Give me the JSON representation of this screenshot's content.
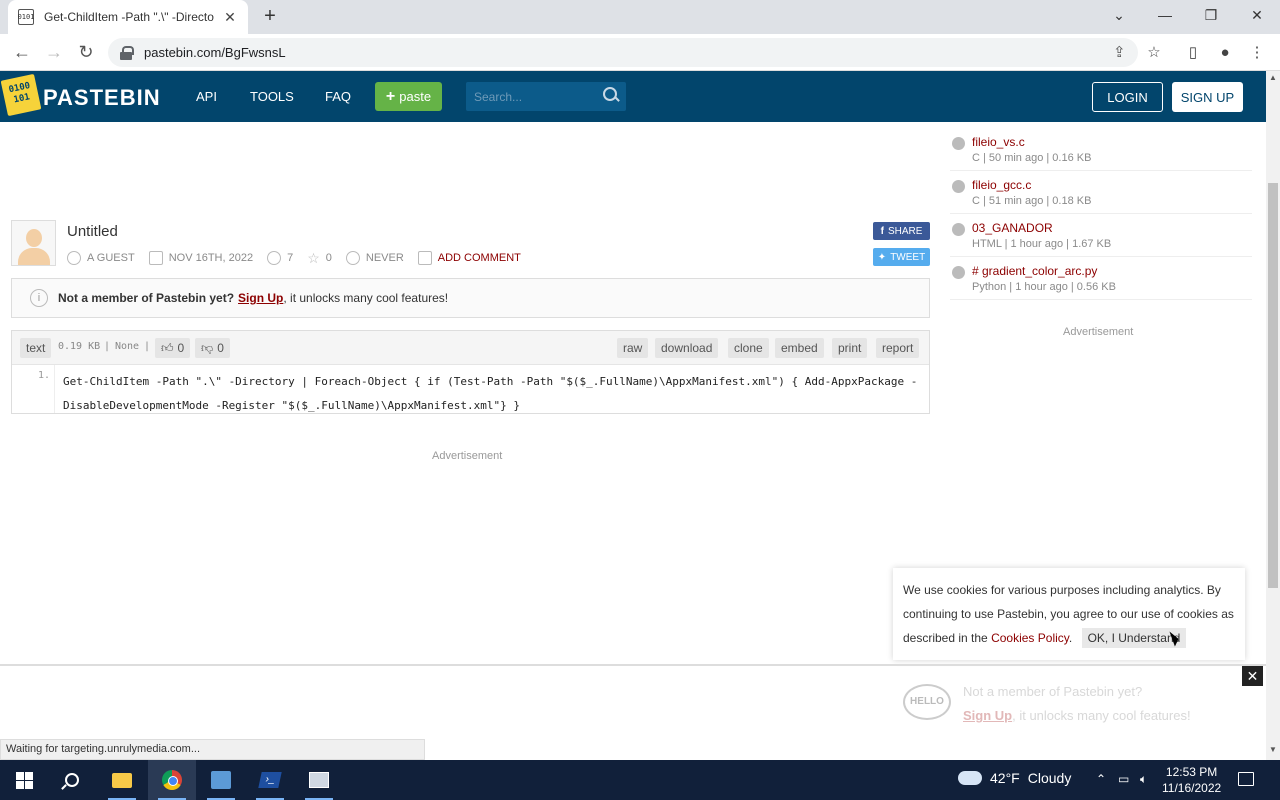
{
  "browser": {
    "tab_title": "Get-ChildItem -Path \".\\\" -Directo",
    "tab_favicon_text": "010\n101",
    "url": "pastebin.com/BgFwsnsL",
    "status_text": "Waiting for targeting.unrulymedia.com..."
  },
  "header": {
    "logo_text": "PASTEBIN",
    "nav": [
      "API",
      "TOOLS",
      "FAQ"
    ],
    "paste_button": "paste",
    "search_placeholder": "Search...",
    "login": "LOGIN",
    "signup": "SIGN UP",
    "brand_color": "#02456c",
    "accent_color": "#65b347"
  },
  "paste": {
    "title": "Untitled",
    "author": "A GUEST",
    "date": "NOV 16TH, 2022",
    "views": "7",
    "stars": "0",
    "expires": "NEVER",
    "add_comment": "ADD COMMENT",
    "share": "SHARE",
    "tweet": "TWEET"
  },
  "notice": {
    "text_bold": "Not a member of Pastebin yet?",
    "signup_link": "Sign Up",
    "text_rest": ", it unlocks many cool features!"
  },
  "code": {
    "syntax": "text",
    "size": "0.19 KB",
    "category": "None",
    "likes": "0",
    "dislikes": "0",
    "actions": [
      "raw",
      "download",
      "clone",
      "embed",
      "print",
      "report"
    ],
    "line_number": "1.",
    "content": "Get-ChildItem -Path \".\\\" -Directory | Foreach-Object { if (Test-Path -Path \"$($_.FullName)\\AppxManifest.xml\") { Add-AppxPackage -DisableDevelopmentMode -Register \"$($_.FullName)\\AppxManifest.xml\"} }"
  },
  "advertisement_label": "Advertisement",
  "sidebar": {
    "items": [
      {
        "title": "fileio_vs.c",
        "meta": "C | 50 min ago | 0.16 KB"
      },
      {
        "title": "fileio_gcc.c",
        "meta": "C | 51 min ago | 0.18 KB"
      },
      {
        "title": "03_GANADOR",
        "meta": "HTML | 1 hour ago | 1.67 KB"
      },
      {
        "title": "# gradient_color_arc.py",
        "meta": "Python | 1 hour ago | 0.56 KB"
      }
    ],
    "advertisement_label": "Advertisement"
  },
  "cookie": {
    "text": "We use cookies for various purposes including analytics. By continuing to use Pastebin, you agree to our use of cookies as described in the",
    "link": "Cookies Policy",
    "after_link": ".",
    "button": "OK, I Understand"
  },
  "sticky": {
    "hello": "HELLO",
    "line1": "Not a member of Pastebin yet?",
    "signup": "Sign Up",
    "line2_rest": ", it unlocks many cool features!"
  },
  "taskbar": {
    "weather_temp": "42°F",
    "weather_desc": "Cloudy",
    "time": "12:53 PM",
    "date": "11/16/2022"
  }
}
